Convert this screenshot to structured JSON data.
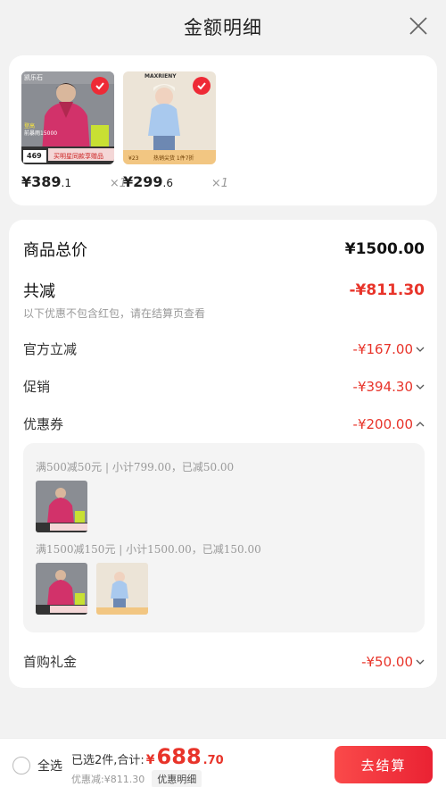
{
  "header": {
    "title": "金额明细"
  },
  "products": [
    {
      "brand": "凯乐石",
      "tag_text": "登高",
      "promo_text": "前暴雨15000",
      "price_badge": "469",
      "banner": "买明星同款享赠品",
      "price_int": "¥389",
      "price_dec": ".1",
      "qty": "×1"
    },
    {
      "brand": "MAXRIENY",
      "promo_text": "热销尖货 1件7折",
      "price_badge": "¥23",
      "price_int": "¥299",
      "price_dec": ".6",
      "qty": "×1"
    }
  ],
  "detail": {
    "total_label": "商品总价",
    "total_value": "¥1500.00",
    "discount_label": "共减",
    "discount_value": "-¥811.30",
    "note": "以下优惠不包含红包，请在结算页查看",
    "items": [
      {
        "label": "官方立减",
        "value": "-¥167.00"
      },
      {
        "label": "促销",
        "value": "-¥394.30"
      },
      {
        "label": "优惠券",
        "value": "-¥200.00"
      }
    ],
    "coupons": [
      {
        "text": "满500减50元 | 小计799.00，已减50.00"
      },
      {
        "text": "满1500减150元 | 小计1500.00，已减150.00"
      }
    ],
    "gift_label": "首购礼金",
    "gift_value": "-¥50.00"
  },
  "bottom": {
    "select_all": "全选",
    "selected_text": "已选2件,合计:",
    "total_symbol": "¥",
    "total_int": "688",
    "total_dec": ".70",
    "saved_text": "优惠减:¥811.30",
    "detail_link": "优惠明细",
    "checkout": "去结算"
  },
  "colors": {
    "accent": "#e8342a",
    "checkout_start": "#fa4a4a",
    "checkout_end": "#ea2233"
  }
}
